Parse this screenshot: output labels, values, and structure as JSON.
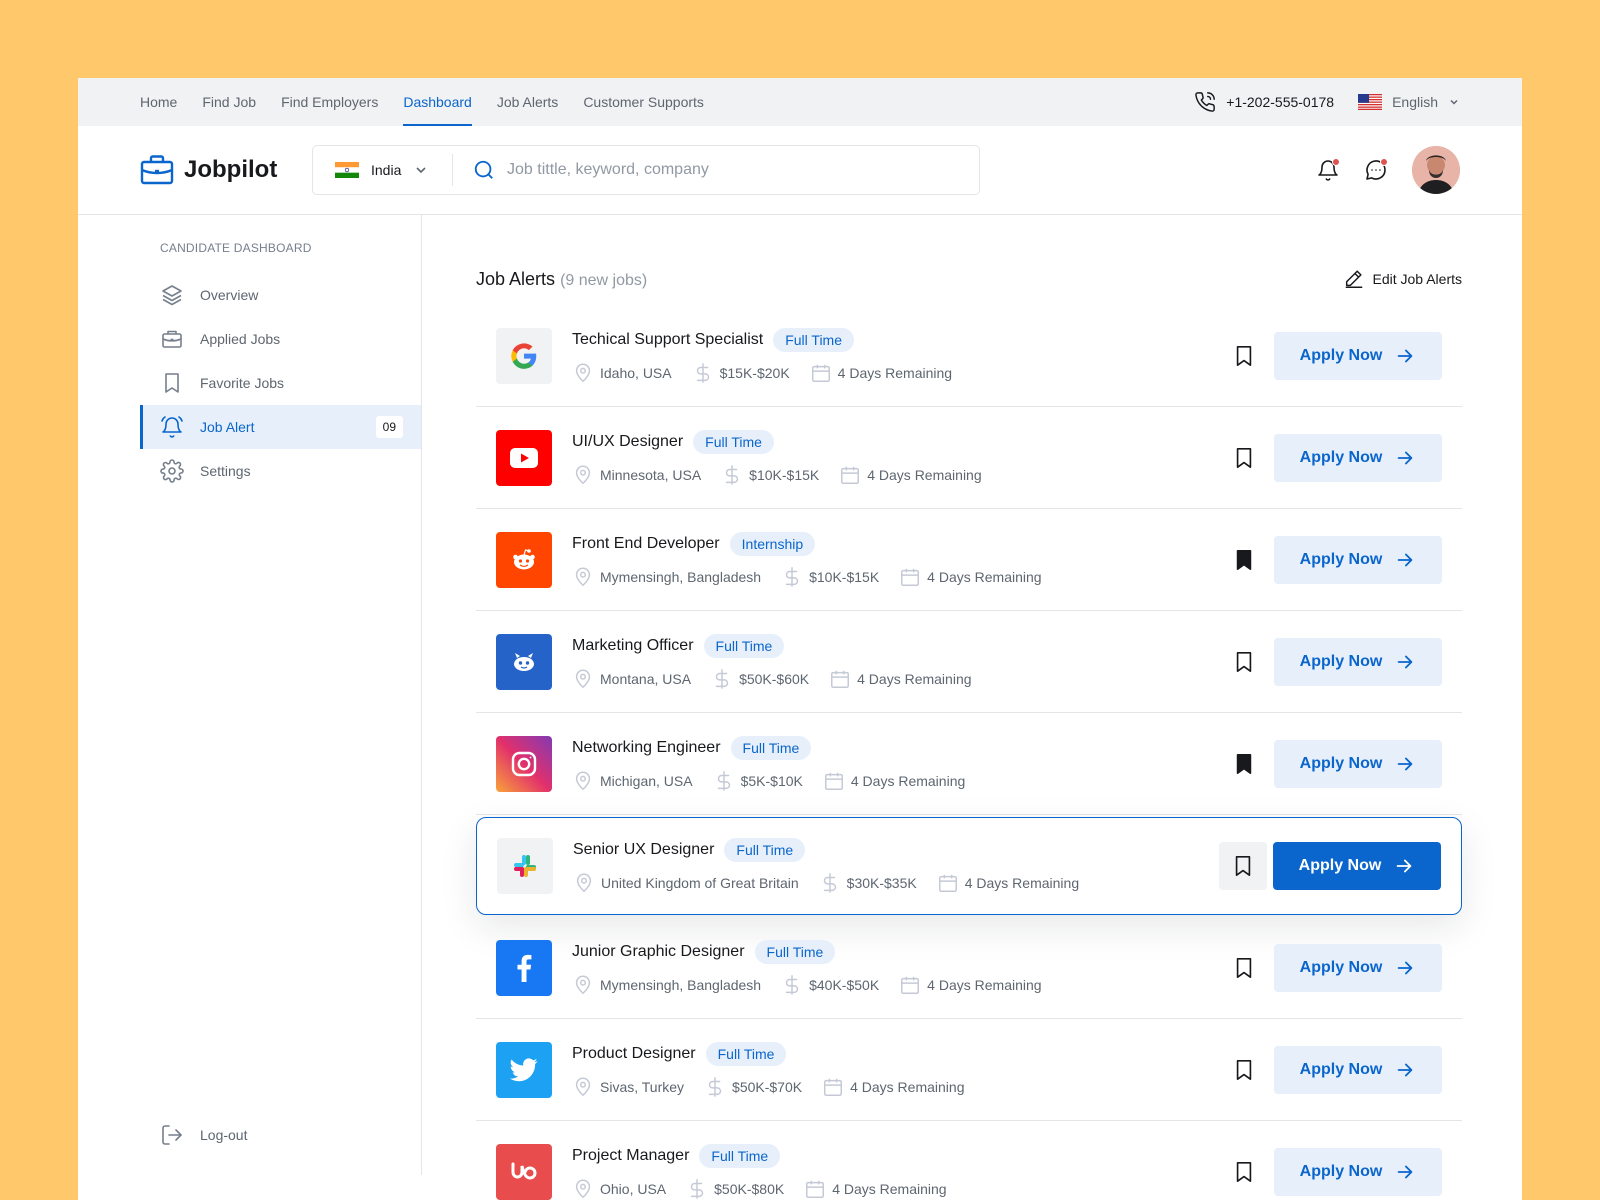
{
  "topnav": {
    "items": [
      "Home",
      "Find Job",
      "Find Employers",
      "Dashboard",
      "Job Alerts",
      "Customer Supports"
    ],
    "active_index": 3,
    "phone": "+1-202-555-0178",
    "language": "English"
  },
  "header": {
    "brand": "Jobpilot",
    "country": "India",
    "search_placeholder": "Job tittle, keyword, company"
  },
  "sidebar": {
    "title": "CANDIDATE DASHBOARD",
    "items": [
      {
        "label": "Overview",
        "icon": "layers-icon"
      },
      {
        "label": "Applied Jobs",
        "icon": "briefcase-icon"
      },
      {
        "label": "Favorite Jobs",
        "icon": "bookmark-icon"
      },
      {
        "label": "Job Alert",
        "icon": "bell-icon",
        "badge": "09",
        "active": true
      },
      {
        "label": "Settings",
        "icon": "gear-icon"
      }
    ],
    "logout": "Log-out"
  },
  "main": {
    "title": "Job Alerts",
    "subtitle": "(9 new jobs)",
    "edit_label": "Edit Job Alerts",
    "apply_label": "Apply Now"
  },
  "jobs": [
    {
      "title": "Techical Support Specialist",
      "type": "Full Time",
      "location": "Idaho, USA",
      "salary": "$15K-$20K",
      "remaining": "4 Days Remaining",
      "company": "google",
      "saved": false
    },
    {
      "title": "UI/UX Designer",
      "type": "Full Time",
      "location": "Minnesota, USA",
      "salary": "$10K-$15K",
      "remaining": "4 Days Remaining",
      "company": "youtube",
      "saved": false
    },
    {
      "title": "Front End Developer",
      "type": "Internship",
      "location": "Mymensingh, Bangladesh",
      "salary": "$10K-$15K",
      "remaining": "4 Days Remaining",
      "company": "reddit",
      "saved": true
    },
    {
      "title": "Marketing Officer",
      "type": "Full Time",
      "location": "Montana, USA",
      "salary": "$50K-$60K",
      "remaining": "4 Days Remaining",
      "company": "discord",
      "saved": false
    },
    {
      "title": "Networking Engineer",
      "type": "Full Time",
      "location": "Michigan, USA",
      "salary": "$5K-$10K",
      "remaining": "4 Days Remaining",
      "company": "instagram",
      "saved": true
    },
    {
      "title": "Senior UX Designer",
      "type": "Full Time",
      "location": "United Kingdom of Great Britain",
      "salary": "$30K-$35K",
      "remaining": "4 Days Remaining",
      "company": "slack",
      "saved": false,
      "highlight": true
    },
    {
      "title": "Junior Graphic Designer",
      "type": "Full Time",
      "location": "Mymensingh, Bangladesh",
      "salary": "$40K-$50K",
      "remaining": "4 Days Remaining",
      "company": "facebook",
      "saved": false
    },
    {
      "title": "Product Designer",
      "type": "Full Time",
      "location": "Sivas, Turkey",
      "salary": "$50K-$70K",
      "remaining": "4 Days Remaining",
      "company": "twitter",
      "saved": false
    },
    {
      "title": "Project Manager",
      "type": "Full Time",
      "location": "Ohio, USA",
      "salary": "$50K-$80K",
      "remaining": "4 Days Remaining",
      "company": "upwork",
      "saved": false
    }
  ],
  "colors": {
    "accent": "#0A65CC",
    "accent_light": "#E7F0FA",
    "background": "#FFC96B"
  }
}
